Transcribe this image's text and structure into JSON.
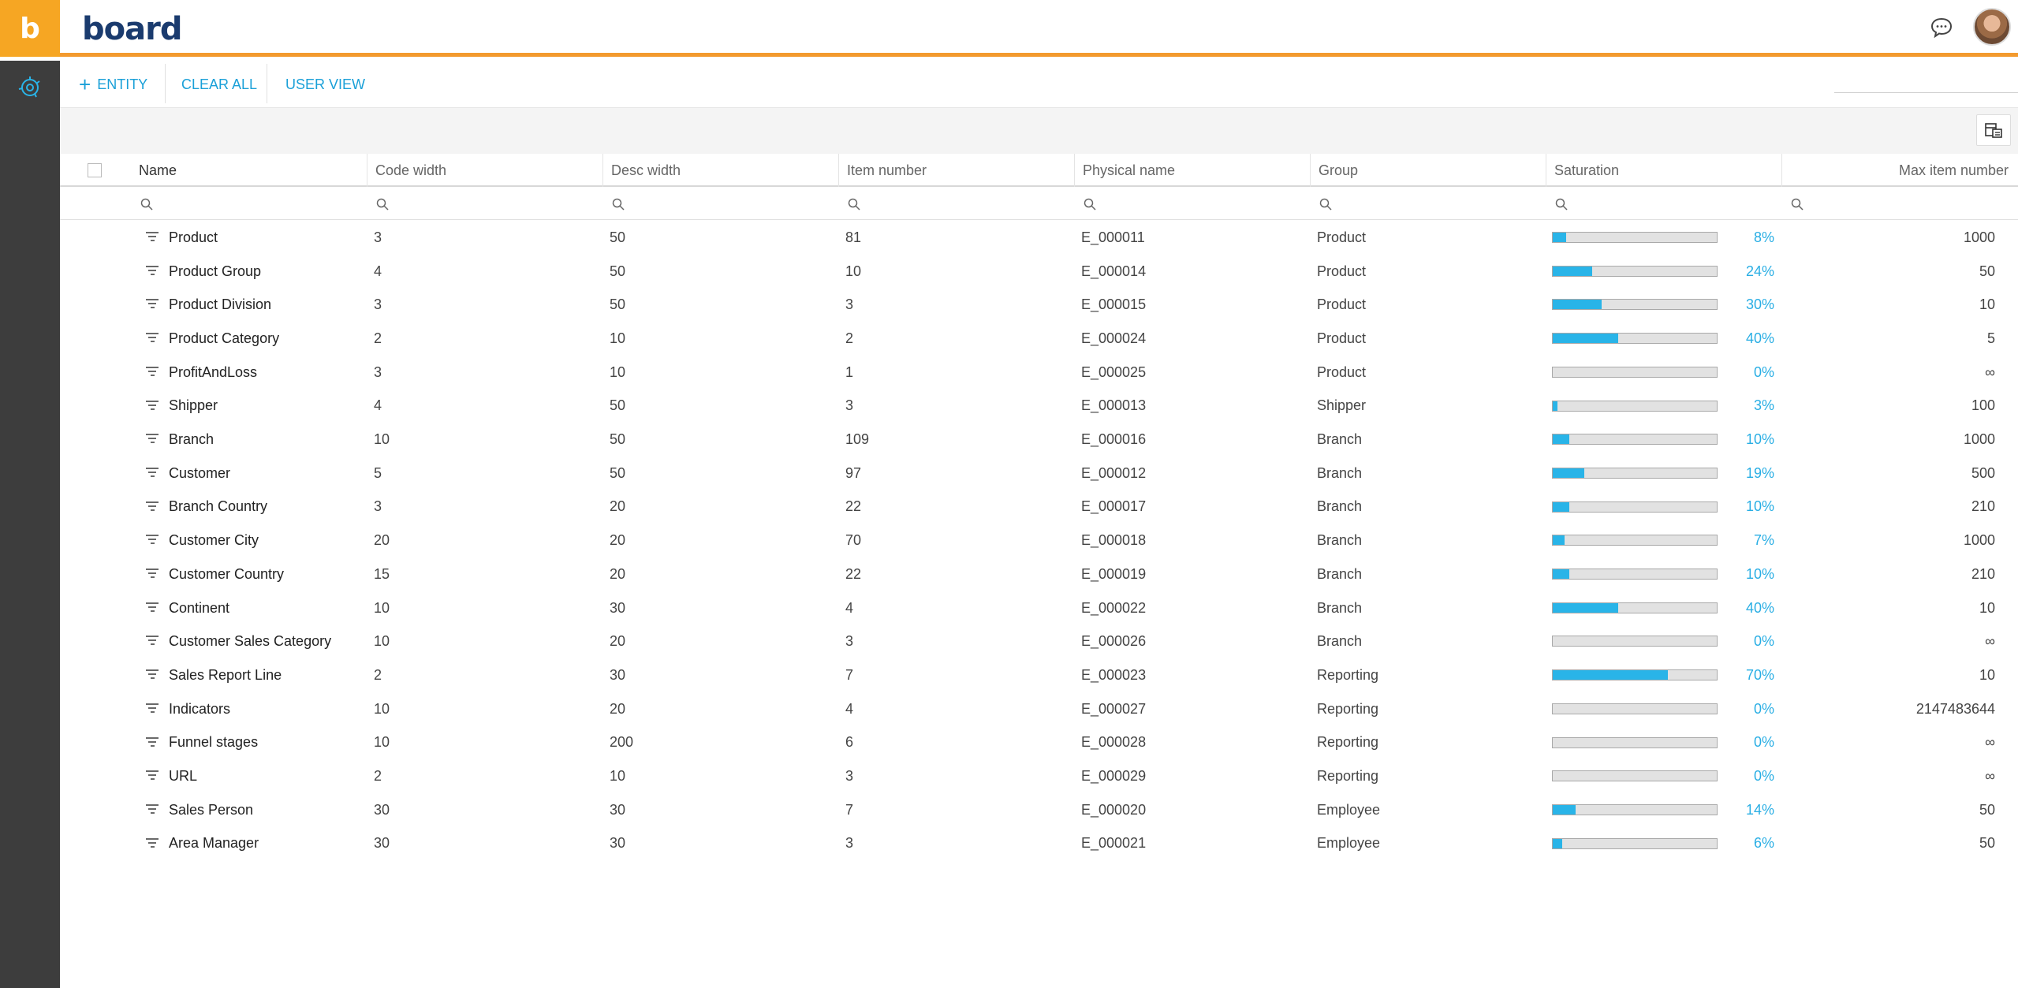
{
  "app": {
    "logo_letter": "b",
    "brand": "board",
    "colors": {
      "accent": "#f39a2e",
      "link": "#1aa0d8",
      "bar": "#29b4e8",
      "sidebar": "#3d3d3d"
    }
  },
  "toolbar": {
    "add_entity_icon": "+",
    "add_entity_label": "ENTITY",
    "clear_all_label": "CLEAR ALL",
    "user_view_label": "USER VIEW"
  },
  "columns": [
    "Name",
    "Code width",
    "Desc width",
    "Item number",
    "Physical name",
    "Group",
    "Saturation",
    "Max item number"
  ],
  "rows": [
    {
      "name": "Product",
      "code_width": "3",
      "desc_width": "50",
      "item_number": "81",
      "physical": "E_000011",
      "group": "Product",
      "saturation": 8,
      "saturation_label": "8%",
      "max": "1000"
    },
    {
      "name": "Product Group",
      "code_width": "4",
      "desc_width": "50",
      "item_number": "10",
      "physical": "E_000014",
      "group": "Product",
      "saturation": 24,
      "saturation_label": "24%",
      "max": "50"
    },
    {
      "name": "Product Division",
      "code_width": "3",
      "desc_width": "50",
      "item_number": "3",
      "physical": "E_000015",
      "group": "Product",
      "saturation": 30,
      "saturation_label": "30%",
      "max": "10"
    },
    {
      "name": "Product Category",
      "code_width": "2",
      "desc_width": "10",
      "item_number": "2",
      "physical": "E_000024",
      "group": "Product",
      "saturation": 40,
      "saturation_label": "40%",
      "max": "5"
    },
    {
      "name": "ProfitAndLoss",
      "code_width": "3",
      "desc_width": "10",
      "item_number": "1",
      "physical": "E_000025",
      "group": "Product",
      "saturation": 0,
      "saturation_label": "0%",
      "max": "∞"
    },
    {
      "name": "Shipper",
      "code_width": "4",
      "desc_width": "50",
      "item_number": "3",
      "physical": "E_000013",
      "group": "Shipper",
      "saturation": 3,
      "saturation_label": "3%",
      "max": "100"
    },
    {
      "name": "Branch",
      "code_width": "10",
      "desc_width": "50",
      "item_number": "109",
      "physical": "E_000016",
      "group": "Branch",
      "saturation": 10,
      "saturation_label": "10%",
      "max": "1000"
    },
    {
      "name": "Customer",
      "code_width": "5",
      "desc_width": "50",
      "item_number": "97",
      "physical": "E_000012",
      "group": "Branch",
      "saturation": 19,
      "saturation_label": "19%",
      "max": "500"
    },
    {
      "name": "Branch Country",
      "code_width": "3",
      "desc_width": "20",
      "item_number": "22",
      "physical": "E_000017",
      "group": "Branch",
      "saturation": 10,
      "saturation_label": "10%",
      "max": "210"
    },
    {
      "name": "Customer City",
      "code_width": "20",
      "desc_width": "20",
      "item_number": "70",
      "physical": "E_000018",
      "group": "Branch",
      "saturation": 7,
      "saturation_label": "7%",
      "max": "1000"
    },
    {
      "name": "Customer Country",
      "code_width": "15",
      "desc_width": "20",
      "item_number": "22",
      "physical": "E_000019",
      "group": "Branch",
      "saturation": 10,
      "saturation_label": "10%",
      "max": "210"
    },
    {
      "name": "Continent",
      "code_width": "10",
      "desc_width": "30",
      "item_number": "4",
      "physical": "E_000022",
      "group": "Branch",
      "saturation": 40,
      "saturation_label": "40%",
      "max": "10"
    },
    {
      "name": "Customer Sales Category",
      "code_width": "10",
      "desc_width": "20",
      "item_number": "3",
      "physical": "E_000026",
      "group": "Branch",
      "saturation": 0,
      "saturation_label": "0%",
      "max": "∞"
    },
    {
      "name": "Sales Report Line",
      "code_width": "2",
      "desc_width": "30",
      "item_number": "7",
      "physical": "E_000023",
      "group": "Reporting",
      "saturation": 70,
      "saturation_label": "70%",
      "max": "10"
    },
    {
      "name": "Indicators",
      "code_width": "10",
      "desc_width": "20",
      "item_number": "4",
      "physical": "E_000027",
      "group": "Reporting",
      "saturation": 0,
      "saturation_label": "0%",
      "max": "2147483644"
    },
    {
      "name": "Funnel stages",
      "code_width": "10",
      "desc_width": "200",
      "item_number": "6",
      "physical": "E_000028",
      "group": "Reporting",
      "saturation": 0,
      "saturation_label": "0%",
      "max": "∞"
    },
    {
      "name": "URL",
      "code_width": "2",
      "desc_width": "10",
      "item_number": "3",
      "physical": "E_000029",
      "group": "Reporting",
      "saturation": 0,
      "saturation_label": "0%",
      "max": "∞"
    },
    {
      "name": "Sales Person",
      "code_width": "30",
      "desc_width": "30",
      "item_number": "7",
      "physical": "E_000020",
      "group": "Employee",
      "saturation": 14,
      "saturation_label": "14%",
      "max": "50"
    },
    {
      "name": "Area Manager",
      "code_width": "30",
      "desc_width": "30",
      "item_number": "3",
      "physical": "E_000021",
      "group": "Employee",
      "saturation": 6,
      "saturation_label": "6%",
      "max": "50"
    }
  ]
}
